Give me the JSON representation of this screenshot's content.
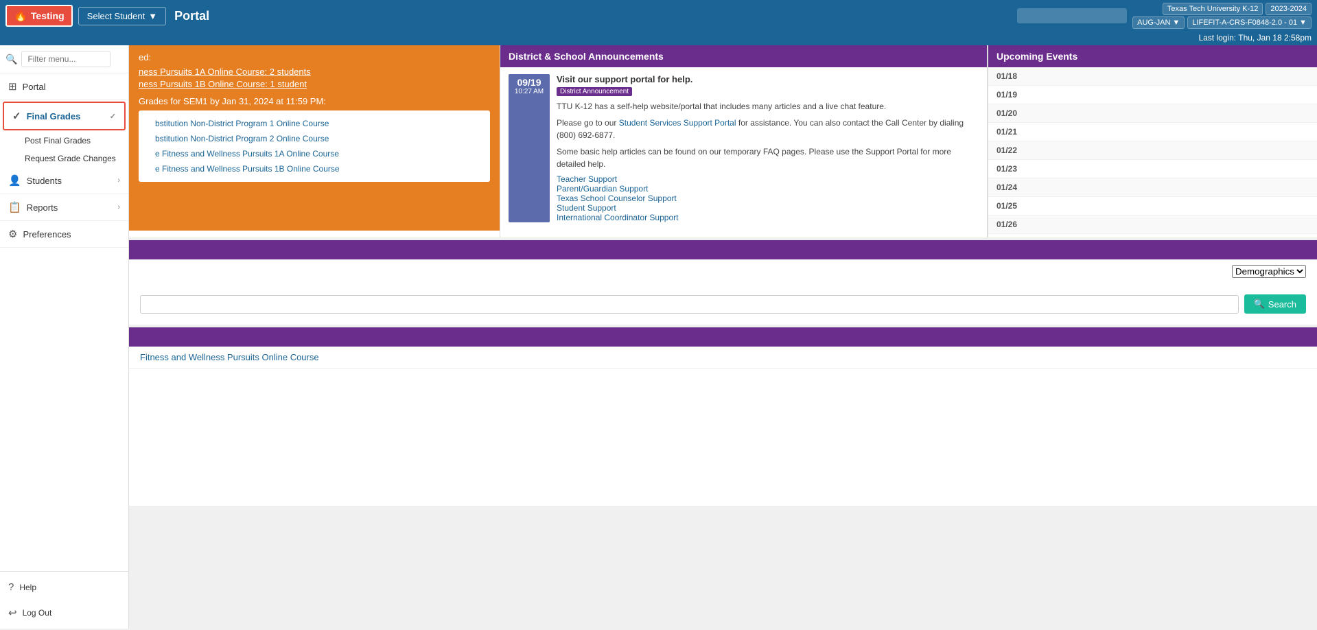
{
  "topbar": {
    "testing_label": "Testing",
    "select_student_label": "Select Student",
    "portal_title": "Portal",
    "university": "Texas Tech University K-12",
    "year": "2023-2024",
    "term": "AUG-JAN",
    "course_code": "LIFEFIT-A-CRS-F0848-2.0 - 01",
    "last_login": "Last login: Thu, Jan 18 2:58pm"
  },
  "sidebar": {
    "filter_placeholder": "Filter menu...",
    "items": [
      {
        "id": "portal",
        "label": "Portal",
        "icon": "⊞",
        "has_children": false
      },
      {
        "id": "final-grades",
        "label": "Final Grades",
        "icon": "✓",
        "has_children": true,
        "expanded": true
      },
      {
        "id": "post-final-grades",
        "label": "Post Final Grades",
        "is_sub": true
      },
      {
        "id": "request-grade-changes",
        "label": "Request Grade Changes",
        "is_sub": true
      },
      {
        "id": "students",
        "label": "Students",
        "icon": "👤",
        "has_children": true
      },
      {
        "id": "reports",
        "label": "Reports",
        "icon": "📊",
        "has_children": true
      },
      {
        "id": "preferences",
        "label": "Preferences",
        "icon": "⚙",
        "has_children": false
      }
    ],
    "bottom_items": [
      {
        "id": "help",
        "label": "Help",
        "icon": "?"
      },
      {
        "id": "logout",
        "label": "Log Out",
        "icon": "→"
      }
    ]
  },
  "orange_banner": {
    "incomplete_label": "ed:",
    "rows": [
      "ness Pursuits 1A Online Course: 2 students",
      "ness Pursuits 1B Online Course: 1 student"
    ],
    "grades_notice": "Grades for SEM1 by Jan 31, 2024 at 11:59 PM:",
    "sub_links": [
      "bstitution Non-District Program 1 Online Course",
      "bstitution Non-District Program 2 Online Course",
      "e Fitness and Wellness Pursuits 1A Online Course",
      "e Fitness and Wellness Pursuits 1B Online Course"
    ]
  },
  "district_announcements": {
    "header": "District & School Announcements",
    "item": {
      "date": "09/19",
      "time": "10:27 AM",
      "title": "Visit our support portal for help.",
      "tag": "District Announcement",
      "body1": "TTU K-12 has a self-help website/portal that includes many articles and a live chat feature.",
      "body2": "Please go to our",
      "support_link_text": "Student Services Support Portal",
      "body3": "for assistance. You can also contact the Call Center by dialing (800) 692-6877.",
      "body4": "Some basic help articles can be found on our temporary FAQ pages. Please use the Support Portal for more detailed help.",
      "links": [
        "Teacher Support",
        "Parent/Guardian Support",
        "Texas School Counselor Support",
        "Student Support",
        "International Coordinator Support"
      ]
    }
  },
  "upcoming_events": {
    "header": "Upcoming Events",
    "dates": [
      "01/18",
      "01/19",
      "01/20",
      "01/21",
      "01/22",
      "01/23",
      "01/24",
      "01/25",
      "01/26"
    ]
  },
  "demographics": {
    "label": "Demographics",
    "options": [
      "Demographics"
    ]
  },
  "search": {
    "button_label": "Search",
    "placeholder": ""
  },
  "course": {
    "name": "Fitness and Wellness Pursuits Online Course"
  },
  "colors": {
    "orange": "#e67e22",
    "purple": "#6b2d8b",
    "blue": "#1a6496",
    "teal": "#1abc9c",
    "red": "#e74c3c"
  }
}
